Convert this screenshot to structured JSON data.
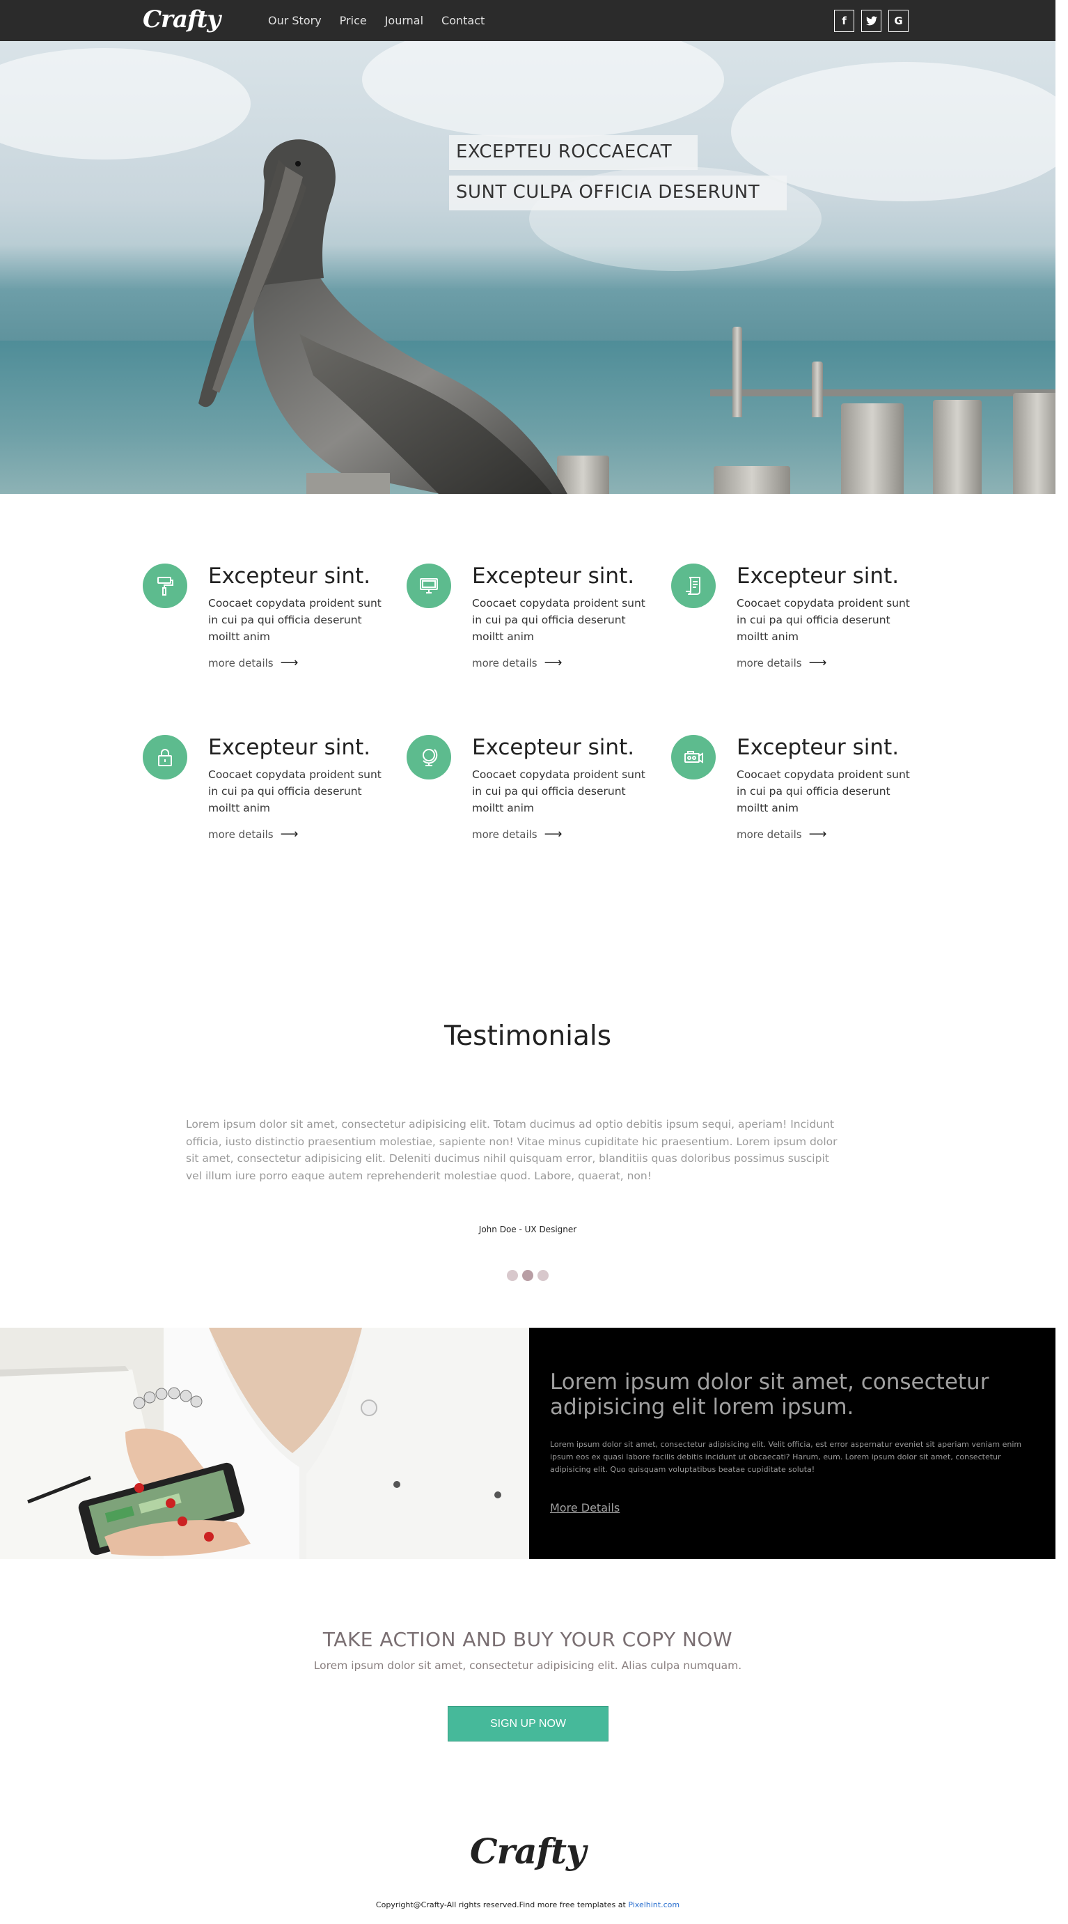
{
  "nav": {
    "logo": "Crafty",
    "links": [
      "Our Story",
      "Price",
      "Journal",
      "Contact"
    ],
    "socials": [
      "f",
      "t",
      "G"
    ]
  },
  "hero": {
    "caption_1": "EXCEPTEU ROCCAECAT",
    "caption_2": "SUNT CULPA OFFICIA DESERUNT"
  },
  "features": [
    {
      "icon": "paint-roller-icon",
      "title": "Excepteur sint.",
      "text": "Coocaet copydata proident sunt in cui pa qui officia deserunt moiltt anim",
      "link": "more details"
    },
    {
      "icon": "monitor-icon",
      "title": "Excepteur sint.",
      "text": "Coocaet copydata proident sunt in cui pa qui officia deserunt moiltt anim",
      "link": "more details"
    },
    {
      "icon": "scroll-icon",
      "title": "Excepteur sint.",
      "text": "Coocaet copydata proident sunt in cui pa qui officia deserunt moiltt anim",
      "link": "more details"
    },
    {
      "icon": "padlock-icon",
      "title": "Excepteur sint.",
      "text": "Coocaet copydata proident sunt in cui pa qui officia deserunt moiltt anim",
      "link": "more details"
    },
    {
      "icon": "globe-icon",
      "title": "Excepteur sint.",
      "text": "Coocaet copydata proident sunt in cui pa qui officia deserunt moiltt anim",
      "link": "more details"
    },
    {
      "icon": "video-camera-icon",
      "title": "Excepteur sint.",
      "text": "Coocaet copydata proident sunt in cui pa qui officia deserunt moiltt anim",
      "link": "more details"
    }
  ],
  "testimonials": {
    "title": "Testimonials",
    "text": "Lorem ipsum dolor sit amet, consectetur adipisicing elit. Totam ducimus ad optio debitis ipsum sequi, aperiam! Incidunt officia, iusto distinctio praesentium molestiae, sapiente non! Vitae minus cupiditate hic praesentium. Lorem ipsum dolor sit amet, consectetur adipisicing elit. Deleniti ducimus nihil quisquam error, blanditiis quas doloribus possimus suscipit vel illum iure porro eaque autem reprehenderit molestiae quod. Labore, quaerat, non!",
    "author": "John Doe - UX Designer",
    "active_slide": 2,
    "slide_count": 3
  },
  "split": {
    "heading": "Lorem ipsum dolor sit amet, consectetur adipisicing elit lorem ipsum.",
    "text": "Lorem ipsum dolor sit amet, consectetur adipisicing elit. Velit officia, est error aspernatur eveniet sit aperiam veniam enim ipsum eos ex quasi labore facilis debitis incidunt ut obcaecati? Harum, eum. Lorem ipsum dolor sit amet, consectetur adipisicing elit. Quo quisquam voluptatibus beatae cupiditate soluta!",
    "link": "More Details"
  },
  "cta": {
    "title": "TAKE ACTION AND BUY YOUR COPY NOW",
    "subtitle": "Lorem ipsum dolor sit amet, consectetur adipisicing elit. Alias culpa numquam.",
    "button": "SIGN UP NOW"
  },
  "footer": {
    "logo": "Crafty",
    "copyright": "Copyright@Crafty-All rights reserved.Find more free templates at ",
    "link": "Pixelhint.com"
  },
  "colors": {
    "accent": "#5dbb8e",
    "button": "#46b99a",
    "nav_bg": "#2b2b2b"
  }
}
